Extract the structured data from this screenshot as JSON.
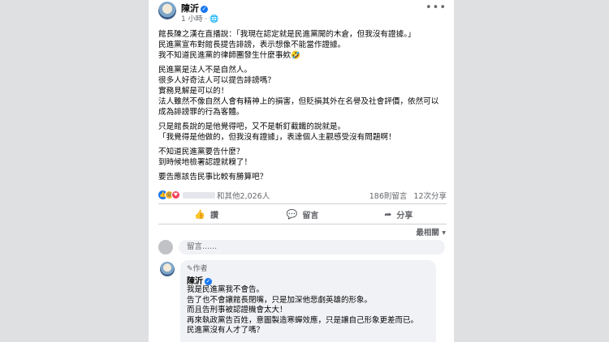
{
  "post": {
    "author": "陳沂",
    "time": "1 小時",
    "privacy_icon": "globe",
    "more_icon": "more-horizontal",
    "paragraphs": [
      [
        "館長陳之漢在直播說：「我現在認定就是民進黨開的木倉，但我沒有證據。」",
        "民進黨宣布對館長提告誹謗，表示想像不能當作證據。",
        "我不知道民進黨的律師團發生什麼事欸🤣"
      ],
      [
        "民進黨是法人不是自然人。",
        "很多人好奇法人可以提告誹謗嗎？",
        "實務見解是可以的！",
        "法人雖然不像自然人會有精神上的損害，但貶損其外在名譽及社會評價，依然可以",
        "成為誹謗罪的行為客體。"
      ],
      [
        "只是館長說的是他覺得吧，又不是斬釘截鐵的說就是。",
        "「我覺得是他做的，但我沒有證據」，表達個人主觀感受沒有問題啊！"
      ],
      [
        "不知道民進黨要告什麼？",
        "到時候地檢署認證就糗了！"
      ],
      [
        "要告應該告民事比較有勝算吧？"
      ]
    ]
  },
  "reactions": {
    "icons": [
      "like",
      "haha",
      "love"
    ],
    "summary": "和其他2,026人",
    "comments": "186則留言",
    "shares": "12次分享"
  },
  "actions": [
    {
      "icon": "like-icon",
      "glyph": "👍",
      "label": "讚"
    },
    {
      "icon": "comment-icon",
      "glyph": "💬",
      "label": "留言"
    },
    {
      "icon": "share-icon",
      "glyph": "➦",
      "label": "分享"
    }
  ],
  "sort": {
    "label": "最相關",
    "icon": "chevron-down"
  },
  "comment_box": {
    "placeholder": "留言......"
  },
  "reply": {
    "badge": "✎作者",
    "name": "陳沂",
    "lines": [
      "我是民進黨我不會告。",
      "告了也不會讓館長閉嘴，只是加深他悲劇英雄的形象。",
      "而且告刑事被認證機會太大！",
      "再來執政黨告百姓，意圖製造寒蟬效應，只是讓自己形象更差而已。",
      "民進黨沒有人才了嗎？"
    ]
  }
}
